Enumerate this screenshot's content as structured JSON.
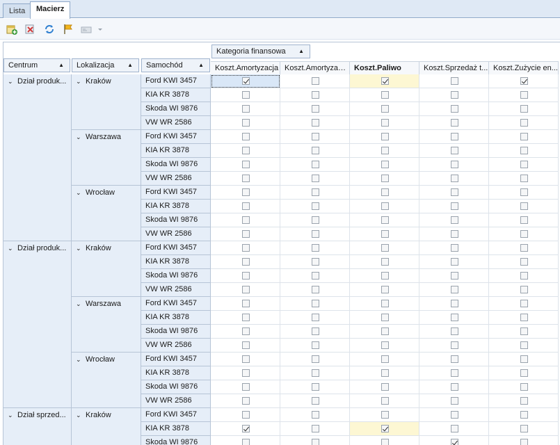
{
  "tabs": [
    {
      "label": "Lista",
      "active": false
    },
    {
      "label": "Macierz",
      "active": true
    }
  ],
  "toolbar": {
    "icons": [
      "add-icon",
      "delete-icon",
      "refresh-icon",
      "flag-icon",
      "filter-icon",
      "dropdown-arrow-icon"
    ]
  },
  "grid": {
    "column_area_header": "Kategoria finansowa",
    "row_headers": [
      "Centrum",
      "Lokalizacja",
      "Samochód"
    ],
    "sort_glyph": "▲",
    "expand_glyph": "⌄",
    "columns": [
      {
        "label": "Koszt.Amortyzacja",
        "bold": false
      },
      {
        "label": "Koszt.Amortyzacja...",
        "bold": false
      },
      {
        "label": "Koszt.Paliwo",
        "bold": true
      },
      {
        "label": "Koszt.Sprzedaż t...",
        "bold": false
      },
      {
        "label": "Koszt.Zużycie en...",
        "bold": false
      }
    ],
    "groups": [
      {
        "centrum": "Dział produk...",
        "locations": [
          {
            "name": "Kraków",
            "cars": [
              {
                "name": "Ford KWI 3457",
                "checks": [
                  true,
                  false,
                  true,
                  false,
                  true
                ]
              },
              {
                "name": "KIA KR 3878",
                "checks": [
                  false,
                  false,
                  false,
                  false,
                  false
                ]
              },
              {
                "name": "Skoda WI 9876",
                "checks": [
                  false,
                  false,
                  false,
                  false,
                  false
                ]
              },
              {
                "name": "VW WR 2586",
                "checks": [
                  false,
                  false,
                  false,
                  false,
                  false
                ]
              }
            ]
          },
          {
            "name": "Warszawa",
            "cars": [
              {
                "name": "Ford KWI 3457",
                "checks": [
                  false,
                  false,
                  false,
                  false,
                  false
                ]
              },
              {
                "name": "KIA KR 3878",
                "checks": [
                  false,
                  false,
                  false,
                  false,
                  false
                ]
              },
              {
                "name": "Skoda WI 9876",
                "checks": [
                  false,
                  false,
                  false,
                  false,
                  false
                ]
              },
              {
                "name": "VW WR 2586",
                "checks": [
                  false,
                  false,
                  false,
                  false,
                  false
                ]
              }
            ]
          },
          {
            "name": "Wrocław",
            "cars": [
              {
                "name": "Ford KWI 3457",
                "checks": [
                  false,
                  false,
                  false,
                  false,
                  false
                ]
              },
              {
                "name": "KIA KR 3878",
                "checks": [
                  false,
                  false,
                  false,
                  false,
                  false
                ]
              },
              {
                "name": "Skoda WI 9876",
                "checks": [
                  false,
                  false,
                  false,
                  false,
                  false
                ]
              },
              {
                "name": "VW WR 2586",
                "checks": [
                  false,
                  false,
                  false,
                  false,
                  false
                ]
              }
            ]
          }
        ]
      },
      {
        "centrum": "Dział produk...",
        "locations": [
          {
            "name": "Kraków",
            "cars": [
              {
                "name": "Ford KWI 3457",
                "checks": [
                  false,
                  false,
                  false,
                  false,
                  false
                ]
              },
              {
                "name": "KIA KR 3878",
                "checks": [
                  false,
                  false,
                  false,
                  false,
                  false
                ]
              },
              {
                "name": "Skoda WI 9876",
                "checks": [
                  false,
                  false,
                  false,
                  false,
                  false
                ]
              },
              {
                "name": "VW WR 2586",
                "checks": [
                  false,
                  false,
                  false,
                  false,
                  false
                ]
              }
            ]
          },
          {
            "name": "Warszawa",
            "cars": [
              {
                "name": "Ford KWI 3457",
                "checks": [
                  false,
                  false,
                  false,
                  false,
                  false
                ]
              },
              {
                "name": "KIA KR 3878",
                "checks": [
                  false,
                  false,
                  false,
                  false,
                  false
                ]
              },
              {
                "name": "Skoda WI 9876",
                "checks": [
                  false,
                  false,
                  false,
                  false,
                  false
                ]
              },
              {
                "name": "VW WR 2586",
                "checks": [
                  false,
                  false,
                  false,
                  false,
                  false
                ]
              }
            ]
          },
          {
            "name": "Wrocław",
            "cars": [
              {
                "name": "Ford KWI 3457",
                "checks": [
                  false,
                  false,
                  false,
                  false,
                  false
                ]
              },
              {
                "name": "KIA KR 3878",
                "checks": [
                  false,
                  false,
                  false,
                  false,
                  false
                ]
              },
              {
                "name": "Skoda WI 9876",
                "checks": [
                  false,
                  false,
                  false,
                  false,
                  false
                ]
              },
              {
                "name": "VW WR 2586",
                "checks": [
                  false,
                  false,
                  false,
                  false,
                  false
                ]
              }
            ]
          }
        ]
      },
      {
        "centrum": "Dział sprzed...",
        "locations": [
          {
            "name": "Kraków",
            "cars": [
              {
                "name": "Ford KWI 3457",
                "checks": [
                  false,
                  false,
                  false,
                  false,
                  false
                ]
              },
              {
                "name": "KIA KR 3878",
                "checks": [
                  true,
                  false,
                  true,
                  false,
                  false
                ]
              },
              {
                "name": "Skoda WI 9876",
                "checks": [
                  false,
                  false,
                  false,
                  true,
                  false
                ]
              }
            ]
          }
        ]
      }
    ]
  }
}
